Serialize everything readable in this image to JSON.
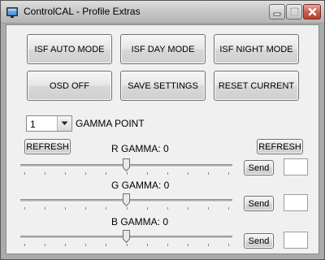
{
  "window": {
    "title": "ControlCAL - Profile Extras"
  },
  "buttons": {
    "isf_auto": "ISF AUTO MODE",
    "isf_day": "ISF DAY MODE",
    "isf_night": "ISF NIGHT MODE",
    "osd_off": "OSD OFF",
    "save_settings": "SAVE SETTINGS",
    "reset_current": "RESET CURRENT"
  },
  "gamma": {
    "selected_point": "1",
    "point_label": "GAMMA POINT",
    "refresh_left": "REFRESH",
    "refresh_right": "REFRESH",
    "channels": [
      {
        "label": "R GAMMA: 0",
        "send": "Send",
        "value": "",
        "slider_level": 0.5
      },
      {
        "label": "G GAMMA: 0",
        "send": "Send",
        "value": "",
        "slider_level": 0.5
      },
      {
        "label": "B GAMMA: 0",
        "send": "Send",
        "value": "",
        "slider_level": 0.5
      }
    ]
  },
  "icons": {
    "app": "controlcal-app-icon",
    "minimize": "minimize-icon",
    "maximize": "maximize-icon",
    "close": "close-icon",
    "dropdown": "chevron-down-icon"
  },
  "colors": {
    "close_button": "#c55a4a",
    "client_background": "#f0f0f0"
  }
}
